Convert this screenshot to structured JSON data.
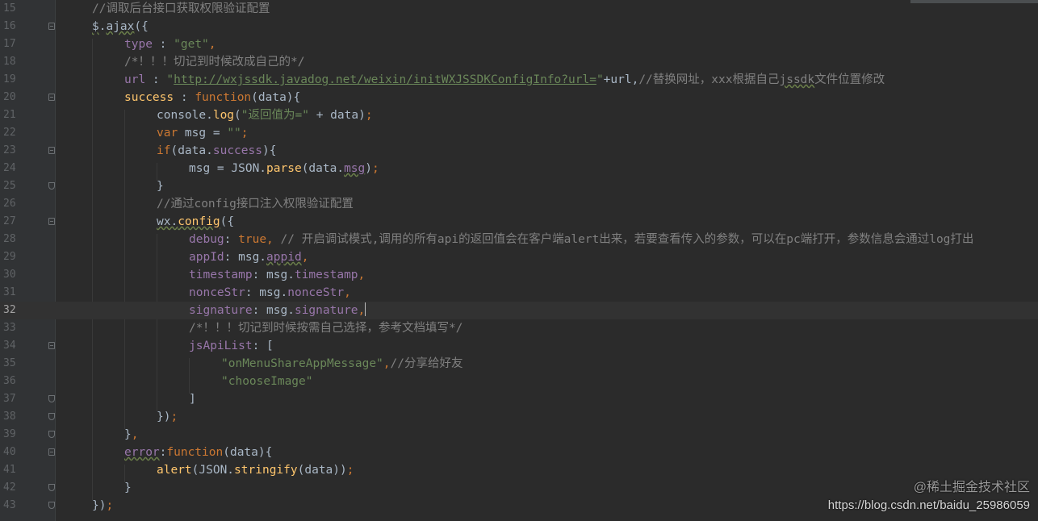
{
  "editor": {
    "lines": [
      {
        "num": "15",
        "t1": "//调取后台接口获取权限验证配置"
      },
      {
        "num": "16",
        "t1": "$",
        "t2": ".",
        "t3": "ajax",
        "t4": "({"
      },
      {
        "num": "17",
        "t1": "type",
        "t2": " : ",
        "t3": "\"get\"",
        "t4": ","
      },
      {
        "num": "18",
        "t1": "/*！！！切记到时候改成自己的*/"
      },
      {
        "num": "19",
        "t1": "url",
        "t2": " : ",
        "t3": "\"",
        "t4": "http://wxjssdk.javadog.net/weixin/initWXJSSDKConfigInfo?url=",
        "t5": "\"",
        "t6": "+url,",
        "t7": "//替换网址，xxx根据自己",
        "t8": "jssdk",
        "t9": "文件位置修改"
      },
      {
        "num": "20",
        "t1": "success",
        "t2": " : ",
        "t3": "function",
        "t4": "(data){"
      },
      {
        "num": "21",
        "t1": "console.",
        "t2": "log",
        "t3": "(",
        "t4": "\"返回值为=\"",
        "t5": " + data)",
        "t6": ";"
      },
      {
        "num": "22",
        "t1": "var",
        "t2": " msg = ",
        "t3": "\"\"",
        "t4": ";"
      },
      {
        "num": "23",
        "t1": "if",
        "t2": "(data.",
        "t3": "success",
        "t4": "){"
      },
      {
        "num": "24",
        "t1": "msg = JSON.",
        "t2": "parse",
        "t3": "(data.",
        "t4": "msg",
        "t5": ")",
        "t6": ";"
      },
      {
        "num": "25",
        "t1": "}"
      },
      {
        "num": "26",
        "t1": "//通过config接口注入权限验证配置"
      },
      {
        "num": "27",
        "t1": "wx.",
        "t2": "config",
        "t3": "({"
      },
      {
        "num": "28",
        "t1": "debug",
        "t2": ": ",
        "t3": "true",
        "t4": ", ",
        "t5": "// 开启调试模式,调用的所有api的返回值会在客户端alert出来，若要查看传入的参数，可以在pc端打开，参数信息会通过log打出"
      },
      {
        "num": "29",
        "t1": "appId",
        "t2": ": msg.",
        "t3": "appid",
        "t4": ","
      },
      {
        "num": "30",
        "t1": "timestamp",
        "t2": ": msg.",
        "t3": "timestamp",
        "t4": ","
      },
      {
        "num": "31",
        "t1": "nonceStr",
        "t2": ": msg.",
        "t3": "nonceStr",
        "t4": ","
      },
      {
        "num": "32",
        "t1": "signature",
        "t2": ": msg.",
        "t3": "signature",
        "t4": ","
      },
      {
        "num": "33",
        "t1": "/*！！！切记到时候按需自己选择，参考文档填写*/"
      },
      {
        "num": "34",
        "t1": "jsApiList",
        "t2": ": ["
      },
      {
        "num": "35",
        "t1": "\"onMenuShareAppMessage\"",
        "t2": ",",
        "t3": "//分享给好友"
      },
      {
        "num": "36",
        "t1": "\"chooseImage\""
      },
      {
        "num": "37",
        "t1": "]"
      },
      {
        "num": "38",
        "t1": "})",
        "t2": ";"
      },
      {
        "num": "39",
        "t1": "}",
        "t2": ","
      },
      {
        "num": "40",
        "t1": "error",
        "t2": ":",
        "t3": "function",
        "t4": "(data){"
      },
      {
        "num": "41",
        "t1": "alert",
        "t2": "(JSON.",
        "t3": "stringify",
        "t4": "(data))",
        "t5": ";"
      },
      {
        "num": "42",
        "t1": "}"
      },
      {
        "num": "43",
        "t1": "})",
        "t2": ";"
      }
    ]
  },
  "watermark": {
    "line1": "@稀土掘金技术社区",
    "line2": "https://blog.csdn.net/baidu_25986059"
  },
  "colors": {
    "background": "#2b2b2b",
    "keyword": "#cc7832",
    "string": "#6a8759",
    "comment": "#808080",
    "property": "#9876aa",
    "function": "#ffc66d",
    "text": "#a9b7c6"
  }
}
